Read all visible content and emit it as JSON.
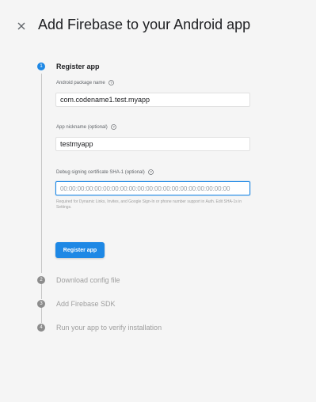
{
  "dialog": {
    "title": "Add Firebase to your Android app",
    "close_icon": "close-icon"
  },
  "steps": [
    {
      "number": "1",
      "label": "Register app",
      "state": "active"
    },
    {
      "number": "2",
      "label": "Download config file",
      "state": "inactive"
    },
    {
      "number": "3",
      "label": "Add Firebase SDK",
      "state": "inactive"
    },
    {
      "number": "4",
      "label": "Run your app to verify installation",
      "state": "inactive"
    }
  ],
  "form": {
    "package_name": {
      "label": "Android package name",
      "value": "com.codename1.test.myapp",
      "help_icon": "help-circle-icon"
    },
    "nickname": {
      "label": "App nickname (optional)",
      "value": "testmyapp",
      "help_icon": "help-circle-icon"
    },
    "sha1": {
      "label": "Debug signing certificate SHA-1 (optional)",
      "value": "",
      "placeholder": "00:00:00:00:00:00:00:00:00:00:00:00:00:00:00:00:00:00:00:00",
      "help_icon": "help-circle-icon",
      "helper_text": "Required for Dynamic Links, Invites, and Google Sign-In or phone number support in Auth. Edit SHA-1s in Settings."
    },
    "submit_label": "Register app"
  },
  "colors": {
    "accent": "#1e88e5",
    "inactive_step": "#8c8c8c",
    "background": "#f5f5f5"
  }
}
